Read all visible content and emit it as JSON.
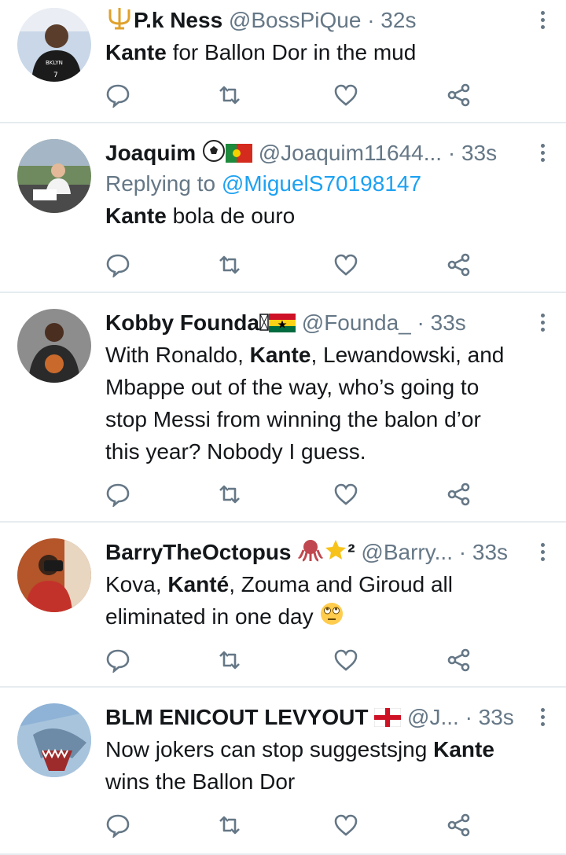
{
  "colors": {
    "text": "#14171a",
    "meta": "#657786",
    "link": "#1da1f2",
    "divider": "#e6ecf0"
  },
  "icons": {
    "reply": "comment-icon",
    "retweet": "retweet-icon",
    "like": "heart-icon",
    "share": "share-icon",
    "more": "more-vertical-icon"
  },
  "tweets": [
    {
      "name": "P.k Ness",
      "handle": "@BossPiQue",
      "time": "· 32s",
      "text": [
        {
          "b": "Kante"
        },
        {
          "t": " for Ballon Dor in the mud"
        }
      ]
    },
    {
      "name": "Joaquim",
      "handle": "@Joaquim11644...",
      "time": "· 33s",
      "reply_prefix": "Replying to",
      "reply_to": "@MiguelS70198147",
      "text": [
        {
          "b": "Kante"
        },
        {
          "t": " bola de ouro"
        }
      ]
    },
    {
      "name": "Kobby Founda",
      "handle": "@Founda_",
      "time": "· 33s",
      "text_lines": [
        [
          {
            "t": "With Ronaldo, "
          },
          {
            "b": "Kante"
          },
          {
            "t": ", Lewandowski, and"
          }
        ],
        [
          {
            "t": "Mbappe out of the way, who’s going to"
          }
        ],
        [
          {
            "t": "stop Messi from winning the balon d’or"
          }
        ],
        [
          {
            "t": "this year? Nobody I guess."
          }
        ]
      ]
    },
    {
      "name": "BarryTheOctopus",
      "name_suffix": "²",
      "handle": "@Barry...",
      "time": "· 33s",
      "text_lines": [
        [
          {
            "t": "Kova, "
          },
          {
            "b": "Kanté"
          },
          {
            "t": ", Zouma and Giroud all"
          }
        ],
        [
          {
            "t": "eliminated in one day "
          }
        ]
      ]
    },
    {
      "name": "BLM ENICOUT LEVYOUT",
      "handle": "@J...",
      "time": "· 33s",
      "text_lines": [
        [
          {
            "t": "Now jokers can stop suggestsjng "
          },
          {
            "b": "Kante"
          }
        ],
        [
          {
            "t": "wins the Ballon Dor"
          }
        ]
      ]
    }
  ]
}
